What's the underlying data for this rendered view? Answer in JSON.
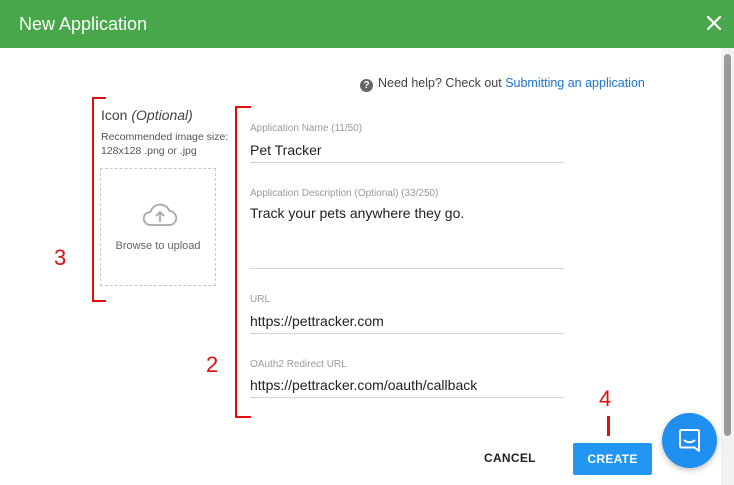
{
  "dialog": {
    "title": "New Application",
    "accent_color": "#47a74a"
  },
  "help": {
    "prefix": "Need help? Check out",
    "link_text": "Submitting an application"
  },
  "icon_panel": {
    "label": "Icon",
    "optional": "(Optional)",
    "hint": "Recommended image size: 128x128 .png or .jpg",
    "upload_text": "Browse to upload"
  },
  "fields": {
    "name": {
      "label": "Application Name (11/50)",
      "value": "Pet Tracker"
    },
    "description": {
      "label": "Application Description (Optional) (33/250)",
      "value": "Track your pets anywhere they go."
    },
    "url": {
      "label": "URL",
      "value": "https://pettracker.com"
    },
    "redirect": {
      "label": "OAuth2 Redirect URL",
      "value": "https://pettracker.com/oauth/callback"
    }
  },
  "annotations": {
    "marker_3": "3",
    "marker_2": "2",
    "marker_4": "4",
    "color": "#e01010"
  },
  "actions": {
    "cancel": "CANCEL",
    "create": "CREATE",
    "create_color": "#2196f3"
  },
  "icons": {
    "close": "close-icon",
    "help": "help-circle-icon",
    "upload": "cloud-upload-icon",
    "chat": "chat-bubble-icon"
  }
}
